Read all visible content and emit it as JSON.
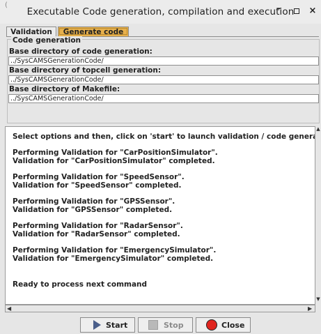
{
  "window": {
    "title": "Executable Code generation, compilation and execution",
    "corner_mark": "(",
    "minimize_glyph": "–",
    "close_glyph": "×"
  },
  "tabs": [
    {
      "label": "Validation",
      "active": false
    },
    {
      "label": "Generate code",
      "active": true
    }
  ],
  "code_generation": {
    "group_title": "Code generation",
    "fields": [
      {
        "label": "Base directory of code generation:",
        "value": "../SysCAMSGenerationCode/"
      },
      {
        "label": "Base directory of topcell generation:",
        "value": "../SysCAMSGenerationCode/"
      },
      {
        "label": "Base directory of Makefile:",
        "value": "../SysCAMSGenerationCode/"
      }
    ]
  },
  "console": {
    "lines": [
      "Select options and then, click on 'start' to launch validation / code generation",
      "Performing Validation for \"CarPositionSimulator\".",
      "Validation for \"CarPositionSimulator\" completed.",
      "Performing Validation for \"SpeedSensor\".",
      "Validation for \"SpeedSensor\" completed.",
      "Performing Validation for \"GPSSensor\".",
      "Validation for \"GPSSensor\" completed.",
      "Performing Validation for \"RadarSensor\".",
      "Validation for \"RadarSensor\" completed.",
      "Performing Validation for \"EmergencySimulator\".",
      "Validation for \"EmergencySimulator\" completed.",
      "Ready to process next command"
    ]
  },
  "buttons": {
    "start": "Start",
    "stop": "Stop",
    "close": "Close"
  },
  "colors": {
    "active_tab": "#e8b14d",
    "close_icon": "#e0241e",
    "start_icon": "#4a5e8a"
  }
}
